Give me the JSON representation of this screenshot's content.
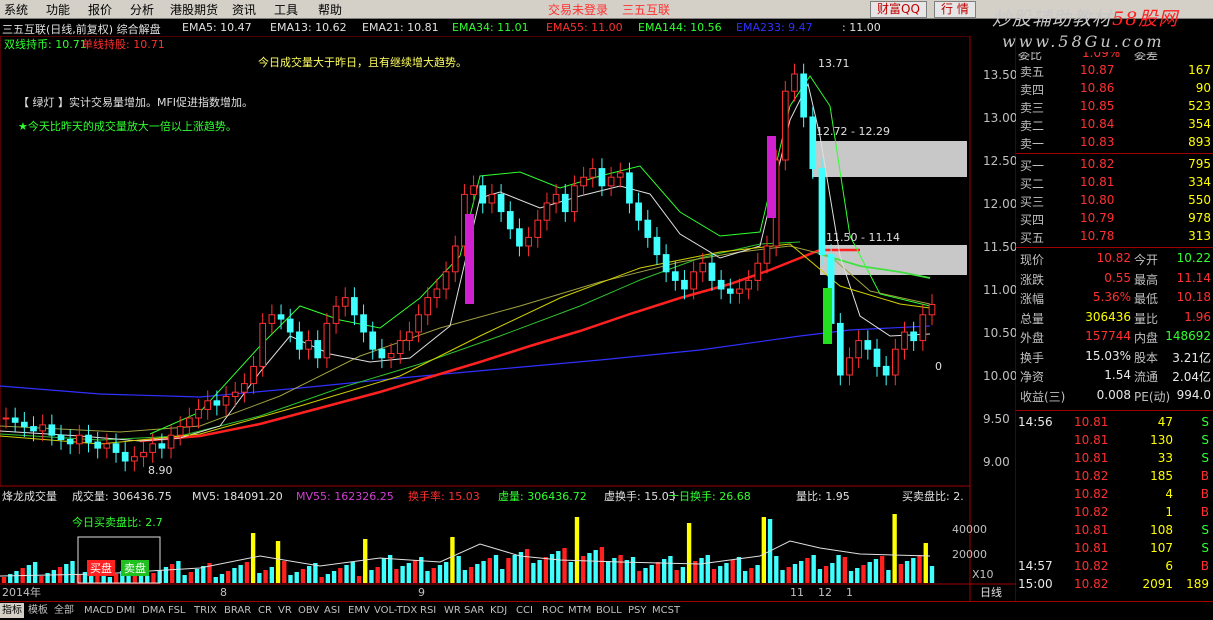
{
  "menu": [
    "系统",
    "功能",
    "报价",
    "分析",
    "港股期货",
    "资讯",
    "工具",
    "帮助"
  ],
  "status": {
    "login": "交易未登录",
    "brand": "三五互联"
  },
  "top_buttons": {
    "left": "财富QQ",
    "right": "行 情"
  },
  "watermark": {
    "line1_a": "炒股辅助教材",
    "line1_b": "58股网",
    "line2": "www.58Gu.com"
  },
  "chart_header": {
    "title": "三五互联(日线,前复权) 综合解盘",
    "ema5": "EMA5: 10.47",
    "ema13": "EMA13: 10.62",
    "ema21": "EMA21: 10.81",
    "ema34": "EMA34: 11.01",
    "ema55": "EMA55: 11.00",
    "ema144": "EMA144: 10.56",
    "ema233": "EMA233: 9.47",
    "extra": ": 11.00"
  },
  "indicator_row": {
    "a": "双线持币: 10.71",
    "b": "单线持股: 10.71"
  },
  "notes": {
    "n1": "今日成交量大于昨日，且有继续增大趋势。",
    "n2": "【 绿灯 】实计交易量增加。MFI促进指数增加。",
    "n3": "★今天比昨天的成交量放大一倍以上涨趋势。"
  },
  "price_axis": [
    "13.50",
    "13.00",
    "12.50",
    "12.00",
    "11.50",
    "11.00",
    "10.50",
    "10.00",
    "9.50",
    "9.00"
  ],
  "annotations": {
    "high": "13.71",
    "zone1": "12.72 - 12.29",
    "zone2": "11.50 - 11.14",
    "low": "8.90",
    "zero": "0"
  },
  "volume_header": {
    "name": "烽龙成交量",
    "vol": "成交量: 306436.75",
    "mv5": "MV5: 184091.20",
    "mv55": "MV55: 162326.25",
    "turnover": "换手率: 15.03",
    "vvol": "虚量: 306436.72",
    "vturn": "虚换手: 15.03",
    "tenturn": "十日换手: 26.68",
    "ratio": "量比: 1.95",
    "bs": "买卖盘比: 2."
  },
  "volume_note": "今日买卖盘比: 2.7",
  "buy_sell_buttons": {
    "buy": "买盘",
    "sell": "卖盘"
  },
  "volume_axis": [
    "40000",
    "20000"
  ],
  "volume_unit": "X10",
  "date_axis": {
    "y2014": "2014年",
    "m8": "8",
    "m9": "9",
    "m11": "11",
    "m12": "12",
    "m1": "1"
  },
  "period": "日线",
  "quote": {
    "partial_top": {
      "label": "委比",
      "val": "1.09%",
      "label2": "委差",
      "val2": ""
    },
    "sells": [
      {
        "label": "卖五",
        "price": "10.87",
        "vol": "167"
      },
      {
        "label": "卖四",
        "price": "10.86",
        "vol": "90"
      },
      {
        "label": "卖三",
        "price": "10.85",
        "vol": "523"
      },
      {
        "label": "卖二",
        "price": "10.84",
        "vol": "354"
      },
      {
        "label": "卖一",
        "price": "10.83",
        "vol": "893"
      }
    ],
    "buys": [
      {
        "label": "买一",
        "price": "10.82",
        "vol": "795"
      },
      {
        "label": "买二",
        "price": "10.81",
        "vol": "334"
      },
      {
        "label": "买三",
        "price": "10.80",
        "vol": "550"
      },
      {
        "label": "买四",
        "price": "10.79",
        "vol": "978"
      },
      {
        "label": "买五",
        "price": "10.78",
        "vol": "313"
      }
    ],
    "stats": [
      {
        "l1": "现价",
        "v1": "10.82",
        "l2": "今开",
        "v2": "10.22"
      },
      {
        "l1": "涨跌",
        "v1": "0.55",
        "l2": "最高",
        "v2": "11.14"
      },
      {
        "l1": "涨幅",
        "v1": "5.36%",
        "l2": "最低",
        "v2": "10.18"
      },
      {
        "l1": "总量",
        "v1": "306436",
        "l2": "量比",
        "v2": "1.96"
      },
      {
        "l1": "外盘",
        "v1": "157744",
        "l2": "内盘",
        "v2": "148692"
      },
      {
        "l1": "换手",
        "v1": "15.03%",
        "l2": "股本",
        "v2": "3.21亿"
      },
      {
        "l1": "净资",
        "v1": "1.54",
        "l2": "流通",
        "v2": "2.04亿"
      },
      {
        "l1": "收益(三)",
        "v1": "0.008",
        "l2": "PE(动)",
        "v2": "994.0"
      }
    ],
    "ticks": [
      {
        "time": "14:56",
        "price": "10.81",
        "vol": "47",
        "bs": "S"
      },
      {
        "time": "",
        "price": "10.81",
        "vol": "130",
        "bs": "S"
      },
      {
        "time": "",
        "price": "10.81",
        "vol": "33",
        "bs": "S"
      },
      {
        "time": "",
        "price": "10.82",
        "vol": "185",
        "bs": "B"
      },
      {
        "time": "",
        "price": "10.82",
        "vol": "4",
        "bs": "B"
      },
      {
        "time": "",
        "price": "10.82",
        "vol": "1",
        "bs": "B"
      },
      {
        "time": "",
        "price": "10.81",
        "vol": "108",
        "bs": "S"
      },
      {
        "time": "",
        "price": "10.81",
        "vol": "107",
        "bs": "S"
      },
      {
        "time": "14:57",
        "price": "10.82",
        "vol": "6",
        "bs": "B"
      },
      {
        "time": "15:00",
        "price": "10.82",
        "vol": "2091",
        "bs": "189"
      }
    ]
  },
  "bottom_tabs": [
    "指标",
    "模板",
    "全部",
    "MACD",
    "DMI",
    "DMA",
    "FSL",
    "TRIX",
    "BRAR",
    "CR",
    "VR",
    "OBV",
    "ASI",
    "EMV",
    "VOL-TDX",
    "RSI",
    "WR",
    "SAR",
    "KDJ",
    "CCI",
    "ROC",
    "MTM",
    "BOLL",
    "PSY",
    "MCST"
  ],
  "colors": {
    "up": "#ff3030",
    "down": "#40ffff",
    "ma_red": "#ff2020",
    "ma_green": "#30d030",
    "ma_blue": "#3030ff",
    "magenta": "#d020d0",
    "zone": "#c8c8c8"
  }
}
